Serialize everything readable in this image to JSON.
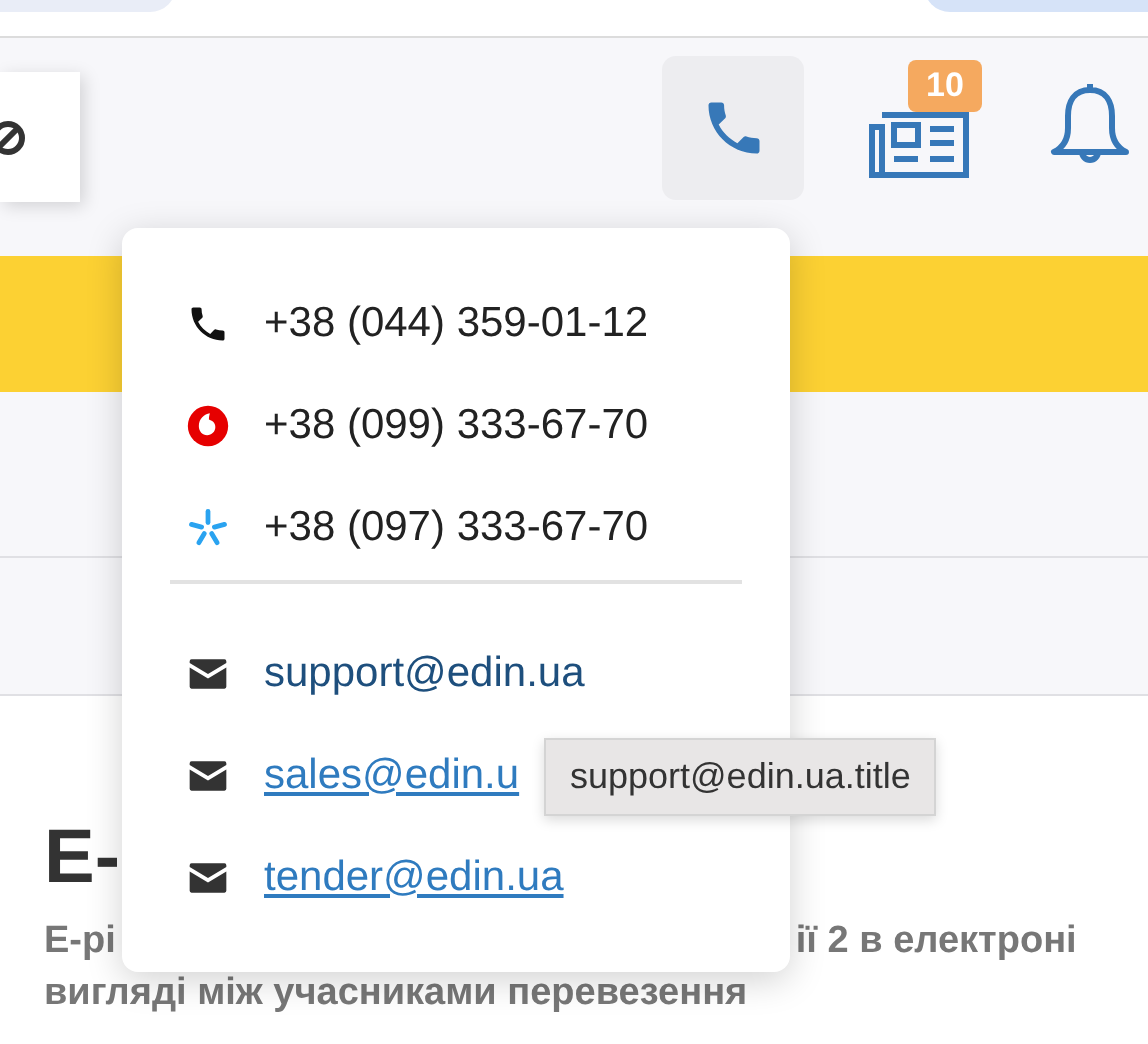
{
  "header": {
    "news_badge": "10"
  },
  "page": {
    "heading": "E-",
    "subtitle_left": "E-рі",
    "subtitle_right": "ії 2 в електроні",
    "subtitle_line2": "вигляді між учасниками перевезення"
  },
  "contacts_popup": {
    "phones": [
      {
        "kind": "landline",
        "number": "+38 (044) 359-01-12"
      },
      {
        "kind": "vodafone",
        "number": "+38 (099) 333-67-70"
      },
      {
        "kind": "kyivstar",
        "number": "+38 (097) 333-67-70"
      }
    ],
    "emails": [
      {
        "address": "support@edin.ua",
        "hovered": true
      },
      {
        "address": "sales@edin.u",
        "hovered": false
      },
      {
        "address": "tender@edin.ua",
        "hovered": false
      }
    ]
  },
  "tooltip": {
    "text": "support@edin.ua.title"
  }
}
